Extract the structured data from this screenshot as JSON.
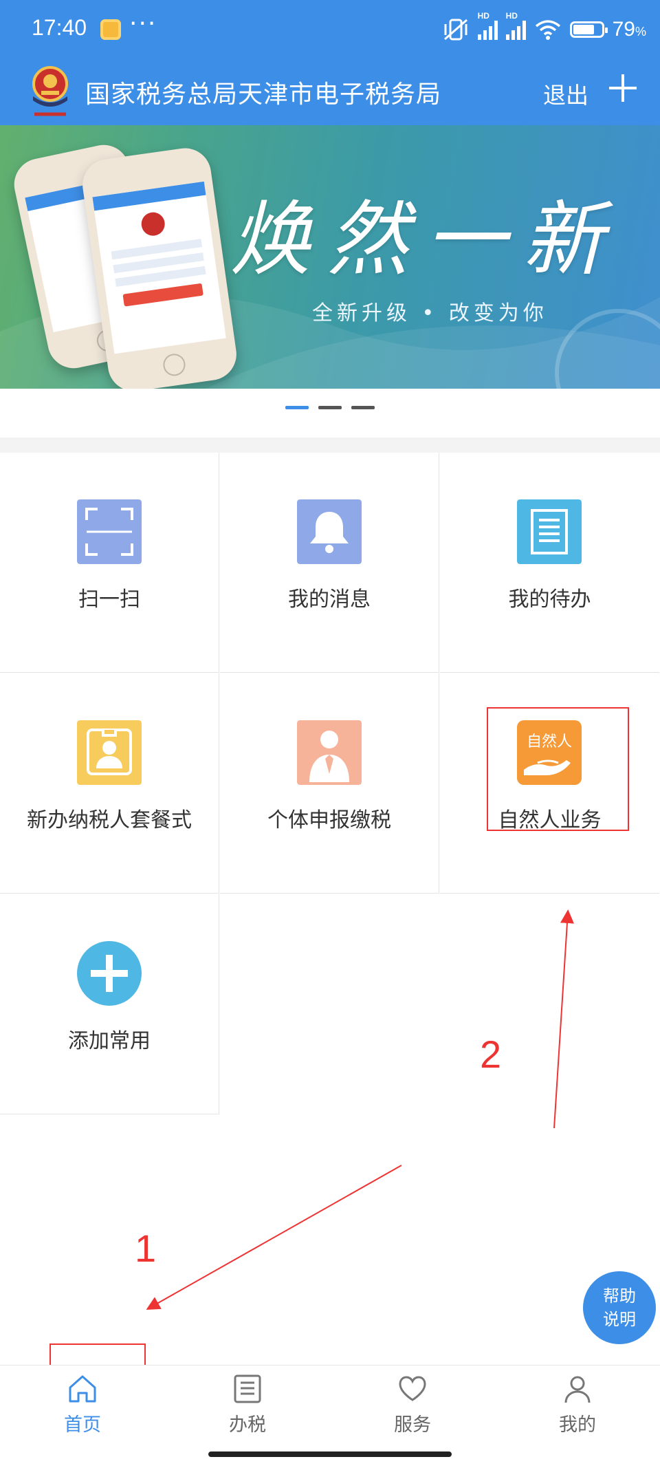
{
  "status_bar": {
    "time": "17:40",
    "dots": "···",
    "signal_label": "HD",
    "battery_percent": "79",
    "battery_unit": "%"
  },
  "header": {
    "title": "国家税务总局天津市电子税务局",
    "logout_label": "退出",
    "logo_icon": "tax-emblem-icon",
    "add_icon": "plus-icon"
  },
  "banner": {
    "slogan": "焕然一新",
    "subtitle": "全新升级 • 改变为你",
    "slide_count": 3,
    "active_slide": 0
  },
  "grid": {
    "items": [
      {
        "label": "扫一扫",
        "icon": "scan-icon",
        "color": "#8fa8e8"
      },
      {
        "label": "我的消息",
        "icon": "bell-icon",
        "color": "#8fa8e8"
      },
      {
        "label": "我的待办",
        "icon": "document-icon",
        "color": "#4fb7e4"
      },
      {
        "label": "新办纳税人套餐式",
        "icon": "id-badge-icon",
        "color": "#f7cc5c"
      },
      {
        "label": "个体申报缴税",
        "icon": "person-tie-icon",
        "color": "#f6b39a"
      },
      {
        "label": "自然人业务",
        "icon": "hand-person-icon",
        "icon_text": "自然人",
        "color": "#f59a36"
      },
      {
        "label": "添加常用",
        "icon": "plus-circle-icon",
        "color": "#4fb7e4"
      }
    ]
  },
  "annotations": {
    "step1": "1",
    "step2": "2",
    "color": "#e33333"
  },
  "help_button": {
    "line1": "帮助",
    "line2": "说明"
  },
  "bottom_nav": {
    "items": [
      {
        "label": "首页",
        "icon": "home-icon",
        "active": true
      },
      {
        "label": "办税",
        "icon": "list-icon",
        "active": false
      },
      {
        "label": "服务",
        "icon": "heart-icon",
        "active": false
      },
      {
        "label": "我的",
        "icon": "user-icon",
        "active": false
      }
    ]
  },
  "colors": {
    "primary": "#3d8ee6",
    "annotation": "#e33333"
  }
}
